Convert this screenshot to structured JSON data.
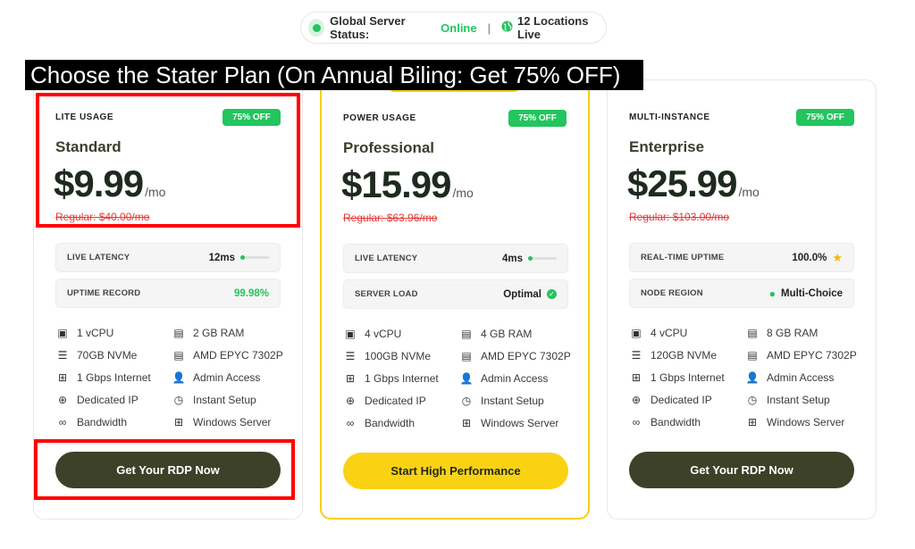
{
  "status": {
    "label": "Global Server Status:",
    "state": "Online",
    "separator": "|",
    "locations": "12 Locations Live"
  },
  "banner": "Choose the Stater Plan (On Annual Biling: Get 75% OFF)",
  "plans": [
    {
      "usage": "LITE USAGE",
      "badge": "75% OFF",
      "name": "Standard",
      "price": "$9.99",
      "per": "/mo",
      "regular": "Regular: $40.00/mo",
      "stats": [
        {
          "label": "LIVE LATENCY",
          "value": "12ms"
        },
        {
          "label": "UPTIME RECORD",
          "value": "99.98%"
        }
      ],
      "features": [
        "1 vCPU",
        "2 GB RAM",
        "70GB NVMe",
        "AMD EPYC 7302P",
        "1 Gbps Internet",
        "Admin Access",
        "Dedicated IP",
        "Instant Setup",
        "Bandwidth",
        "Windows Server"
      ],
      "cta": "Get Your RDP Now"
    },
    {
      "usage": "POWER USAGE",
      "badge": "75% OFF",
      "name": "Professional",
      "price": "$15.99",
      "per": "/mo",
      "regular": "Regular: $63.96/mo",
      "stats": [
        {
          "label": "LIVE LATENCY",
          "value": "4ms"
        },
        {
          "label": "SERVER LOAD",
          "value": "Optimal"
        }
      ],
      "features": [
        "4 vCPU",
        "4 GB RAM",
        "100GB NVMe",
        "AMD EPYC 7302P",
        "1 Gbps Internet",
        "Admin Access",
        "Dedicated IP",
        "Instant Setup",
        "Bandwidth",
        "Windows Server"
      ],
      "cta": "Start High Performance"
    },
    {
      "usage": "MULTI-INSTANCE",
      "badge": "75% OFF",
      "name": "Enterprise",
      "price": "$25.99",
      "per": "/mo",
      "regular": "Regular: $103.00/mo",
      "stats": [
        {
          "label": "REAL-TIME UPTIME",
          "value": "100.0%"
        },
        {
          "label": "NODE REGION",
          "value": "Multi-Choice"
        }
      ],
      "features": [
        "4 vCPU",
        "8 GB RAM",
        "120GB NVMe",
        "AMD EPYC 7302P",
        "1 Gbps Internet",
        "Admin Access",
        "Dedicated IP",
        "Instant Setup",
        "Bandwidth",
        "Windows Server"
      ],
      "cta": "Get Your RDP Now"
    }
  ],
  "colors": {
    "accent_green": "#22c55e",
    "dark_olive": "#3c4128",
    "yellow": "#fad214",
    "highlight_red": "#ff0000"
  }
}
